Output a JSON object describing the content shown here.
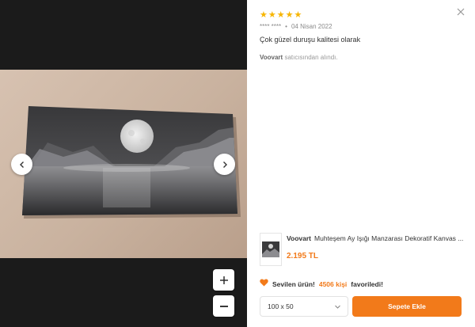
{
  "review": {
    "rating": 5,
    "stars": [
      "★",
      "★",
      "★",
      "★",
      "★"
    ],
    "author": "**** ****",
    "separator": "•",
    "date": "04 Nisan 2022",
    "comment": "Çok güzel duruşu kalitesi olarak",
    "seller_name": "Voovart",
    "seller_suffix": "satıcısından alındı."
  },
  "product": {
    "brand": "Voovart",
    "title": "Muhteşem Ay Işığı Manzarası Dekoratif Kanvas ...",
    "price": "2.195 TL"
  },
  "favorite": {
    "prefix": "Sevilen ürün!",
    "count": "4506 kişi",
    "suffix": "favoriledi!"
  },
  "size_select": {
    "value": "100 x 50"
  },
  "buttons": {
    "add_to_cart": "Sepete Ekle"
  },
  "icons": {
    "close": "close-icon",
    "prev": "chevron-left-icon",
    "next": "chevron-right-icon",
    "zoom_in": "plus-icon",
    "zoom_out": "minus-icon",
    "heart": "heart-icon",
    "dropdown": "chevron-down-icon"
  },
  "colors": {
    "accent": "#f27a1a",
    "star": "#f7b500"
  }
}
